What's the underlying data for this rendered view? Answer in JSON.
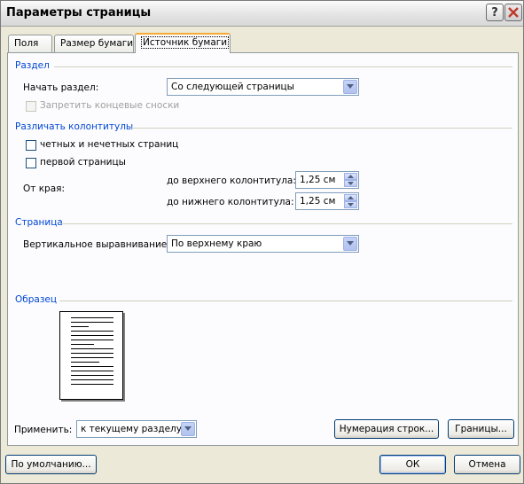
{
  "window": {
    "title": "Параметры страницы"
  },
  "titlebar": {
    "help_glyph": "?",
    "close_glyph": "✕"
  },
  "tabs": [
    {
      "label": "Поля"
    },
    {
      "label": "Размер бумаги"
    },
    {
      "label": "Источник бумаги"
    }
  ],
  "section": {
    "group_label": "Раздел",
    "start_label": "Начать раздел:",
    "start_value": "Со следующей страницы",
    "suppress_endnotes_label": "Запретить концевые сноски"
  },
  "headers_footers": {
    "group_label": "Различать колонтитулы",
    "odd_even_label": "четных и нечетных страниц",
    "first_page_label": "первой страницы",
    "from_edge_label": "От края:",
    "header_label": "до верхнего колонтитула:",
    "header_value": "1,25 см",
    "footer_label": "до нижнего колонтитула:",
    "footer_value": "1,25 см"
  },
  "page": {
    "group_label": "Страница",
    "vertical_alignment_label": "Вертикальное выравнивание:",
    "vertical_alignment_value": "По верхнему краю"
  },
  "preview": {
    "group_label": "Образец"
  },
  "apply": {
    "label": "Применить:",
    "value": "к текущему разделу"
  },
  "buttons": {
    "line_numbers": "Нумерация строк...",
    "borders": "Границы...",
    "default": "По умолчанию...",
    "ok": "ОК",
    "cancel": "Отмена"
  }
}
